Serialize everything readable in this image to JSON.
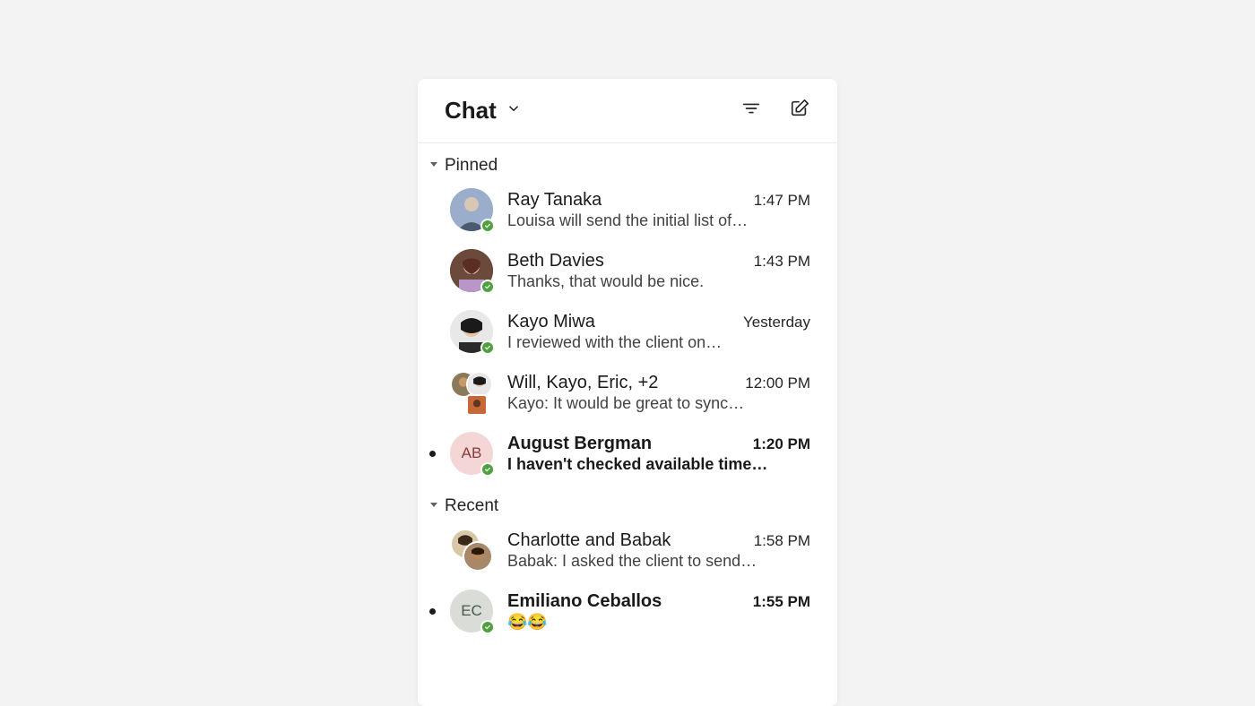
{
  "header": {
    "title": "Chat"
  },
  "sections": {
    "pinned": {
      "label": "Pinned"
    },
    "recent": {
      "label": "Recent"
    }
  },
  "pinned_items": [
    {
      "name": "Ray Tanaka",
      "preview": "Louisa will send the initial list of…",
      "time": "1:47 PM",
      "unread": false,
      "avatar_type": "photo",
      "initials": "",
      "avatar_bg": "#9aa8c0",
      "presence": true
    },
    {
      "name": "Beth Davies",
      "preview": "Thanks, that would be nice.",
      "time": "1:43 PM",
      "unread": false,
      "avatar_type": "photo",
      "initials": "",
      "avatar_bg": "#8b5a4a",
      "presence": true
    },
    {
      "name": "Kayo Miwa",
      "preview": "I reviewed with the client on…",
      "time": "Yesterday",
      "unread": false,
      "avatar_type": "photo",
      "initials": "",
      "avatar_bg": "#d6d6d6",
      "presence": true
    },
    {
      "name": "Will, Kayo, Eric, +2",
      "preview": "Kayo: It would be great to sync…",
      "time": "12:00 PM",
      "unread": false,
      "avatar_type": "group",
      "initials": "",
      "avatar_bg": "",
      "presence": false
    },
    {
      "name": "August Bergman",
      "preview": "I haven't checked available time…",
      "time": "1:20 PM",
      "unread": true,
      "avatar_type": "initials",
      "initials": "AB",
      "avatar_bg": "#f5d6d6",
      "presence": true
    }
  ],
  "recent_items": [
    {
      "name": "Charlotte and Babak",
      "preview": "Babak: I asked the client to send…",
      "time": "1:58 PM",
      "unread": false,
      "avatar_type": "pair",
      "initials": "",
      "avatar_bg": "",
      "presence": false
    },
    {
      "name": "Emiliano Ceballos",
      "preview": "😂😂",
      "time": "1:55 PM",
      "unread": true,
      "avatar_type": "initials",
      "initials": "EC",
      "avatar_bg": "#d9dcd7",
      "presence": true
    }
  ]
}
